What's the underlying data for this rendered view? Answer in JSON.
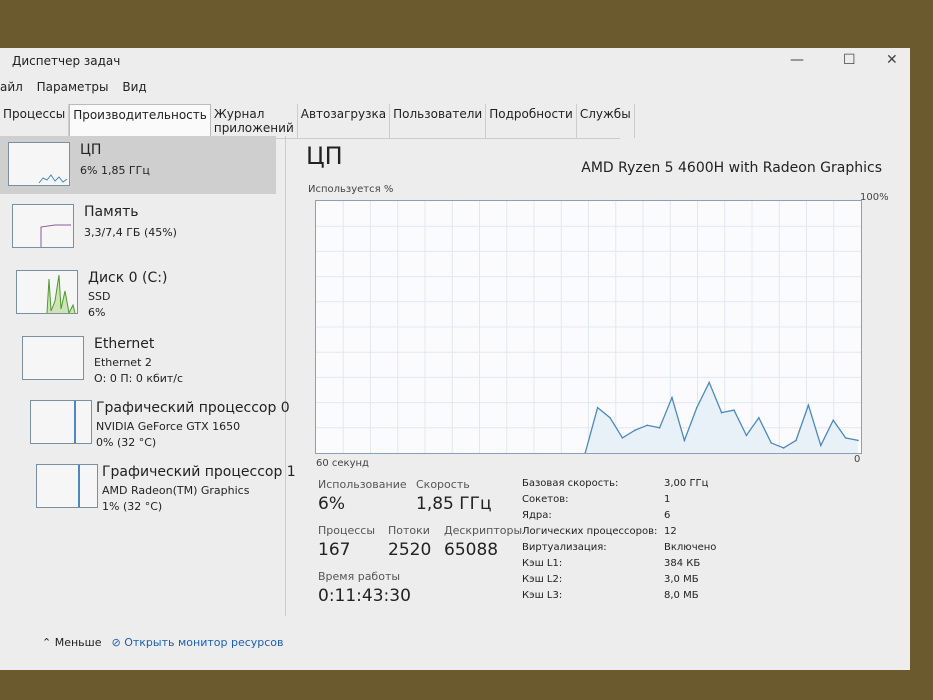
{
  "window": {
    "title": "Диспетчер задач"
  },
  "menu": [
    "айл",
    "Параметры",
    "Вид"
  ],
  "tabs": [
    "Процессы",
    "Производительность",
    "Журнал приложений",
    "Автозагрузка",
    "Пользователи",
    "Подробности",
    "Службы"
  ],
  "sidebar": [
    {
      "name": "ЦП",
      "l1": "6% 1,85 ГГц"
    },
    {
      "name": "Память",
      "l1": "3,3/7,4 ГБ (45%)"
    },
    {
      "name": "Диск 0 (C:)",
      "l1": "SSD",
      "l2": "6%"
    },
    {
      "name": "Ethernet",
      "l1": "Ethernet 2",
      "l2": "О: 0 П: 0 кбит/с"
    },
    {
      "name": "Графический процессор 0",
      "l1": "NVIDIA GeForce GTX 1650",
      "l2": "0% (32 °C)"
    },
    {
      "name": "Графический процессор 1",
      "l1": "AMD Radeon(TM) Graphics",
      "l2": "1% (32 °C)"
    }
  ],
  "main": {
    "title": "ЦП",
    "model": "AMD Ryzen 5 4600H with Radeon Graphics",
    "ylabel": "Используется %",
    "ymax": "100%",
    "xlabel": "60 секунд",
    "ymin": "0"
  },
  "chart_data": {
    "type": "line",
    "title": "Используется %",
    "ylim": [
      0,
      100
    ],
    "xlim": [
      60,
      0
    ],
    "values": [
      0,
      18,
      14,
      6,
      9,
      11,
      10,
      22,
      5,
      18,
      28,
      16,
      17,
      7,
      14,
      4,
      2,
      5,
      19,
      3,
      13,
      6,
      5
    ]
  },
  "stats": {
    "usage_l": "Использование",
    "usage": "6%",
    "speed_l": "Скорость",
    "speed": "1,85 ГГц",
    "proc_l": "Процессы",
    "proc": "167",
    "thr_l": "Потоки",
    "thr": "2520",
    "desc_l": "Дескрипторы",
    "desc": "65088",
    "up_l": "Время работы",
    "up": "0:11:43:30"
  },
  "specs": [
    [
      "Базовая скорость:",
      "3,00 ГГц"
    ],
    [
      "Сокетов:",
      "1"
    ],
    [
      "Ядра:",
      "6"
    ],
    [
      "Логических процессоров:",
      "12"
    ],
    [
      "Виртуализация:",
      "Включено"
    ],
    [
      "Кэш L1:",
      "384 КБ"
    ],
    [
      "Кэш L2:",
      "3,0 МБ"
    ],
    [
      "Кэш L3:",
      "8,0 МБ"
    ]
  ],
  "footer": {
    "less": "Меньше",
    "monitor": "Открыть монитор ресурсов"
  },
  "colors": {
    "cpu": "#4a8ac0",
    "disk": "#4d9a2a"
  }
}
